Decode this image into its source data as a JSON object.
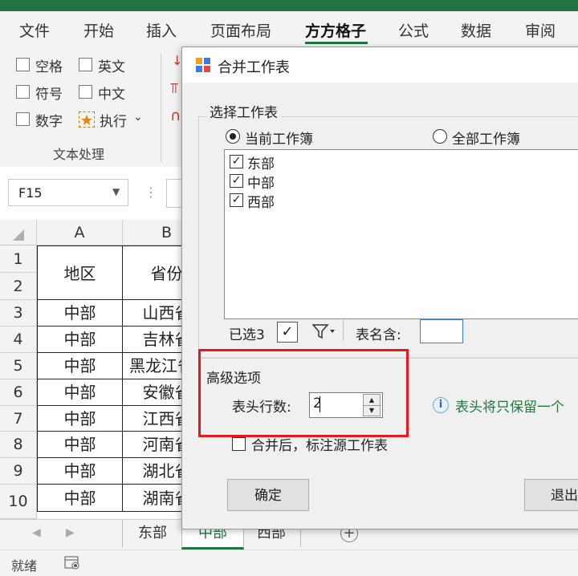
{
  "ribbon_tabs": [
    "文件",
    "开始",
    "插入",
    "页面布局",
    "方方格子",
    "公式",
    "数据",
    "审阅"
  ],
  "ribbon_group": {
    "checks": [
      {
        "label": "空格"
      },
      {
        "label": "英文"
      },
      {
        "label": "符号"
      },
      {
        "label": "中文"
      },
      {
        "label": "数字"
      }
    ],
    "execute_label": "执行",
    "group_label": "文本处理"
  },
  "name_box": "F15",
  "grid": {
    "col_headers": [
      "A",
      "B"
    ],
    "row_headers": [
      "1",
      "2",
      "3",
      "4",
      "5",
      "6",
      "7",
      "8",
      "9",
      "10"
    ],
    "header_cells": [
      "地区",
      "省份"
    ],
    "rows": [
      [
        "中部",
        "山西省"
      ],
      [
        "中部",
        "吉林省"
      ],
      [
        "中部",
        "黑龙江省"
      ],
      [
        "中部",
        "安徽省"
      ],
      [
        "中部",
        "江西省"
      ],
      [
        "中部",
        "河南省"
      ],
      [
        "中部",
        "湖北省"
      ],
      [
        "中部",
        "湖南省"
      ]
    ]
  },
  "sheet_tabs": [
    "东部",
    "中部",
    "西部"
  ],
  "status_text": "就绪",
  "dialog": {
    "title": "合并工作表",
    "section_label": "选择工作表",
    "radio_current": "当前工作簿",
    "radio_all": "全部工作簿",
    "sheets": [
      {
        "name": "东部",
        "checked": true
      },
      {
        "name": "中部",
        "checked": true
      },
      {
        "name": "西部",
        "checked": true
      }
    ],
    "selected_count_label": "已选3",
    "name_contains_label": "表名含:",
    "name_contains_value": "",
    "advanced_label": "高级选项",
    "header_rows_label": "表头行数:",
    "header_rows_value": "2",
    "info_text": "表头将只保留一个",
    "mark_source_label": "合并后，标注源工作表",
    "ok_label": "确定",
    "exit_label": "退出"
  },
  "colors": {
    "excel_green": "#217346",
    "highlight_red": "#e8191d",
    "info_green": "#1e7a3a"
  }
}
